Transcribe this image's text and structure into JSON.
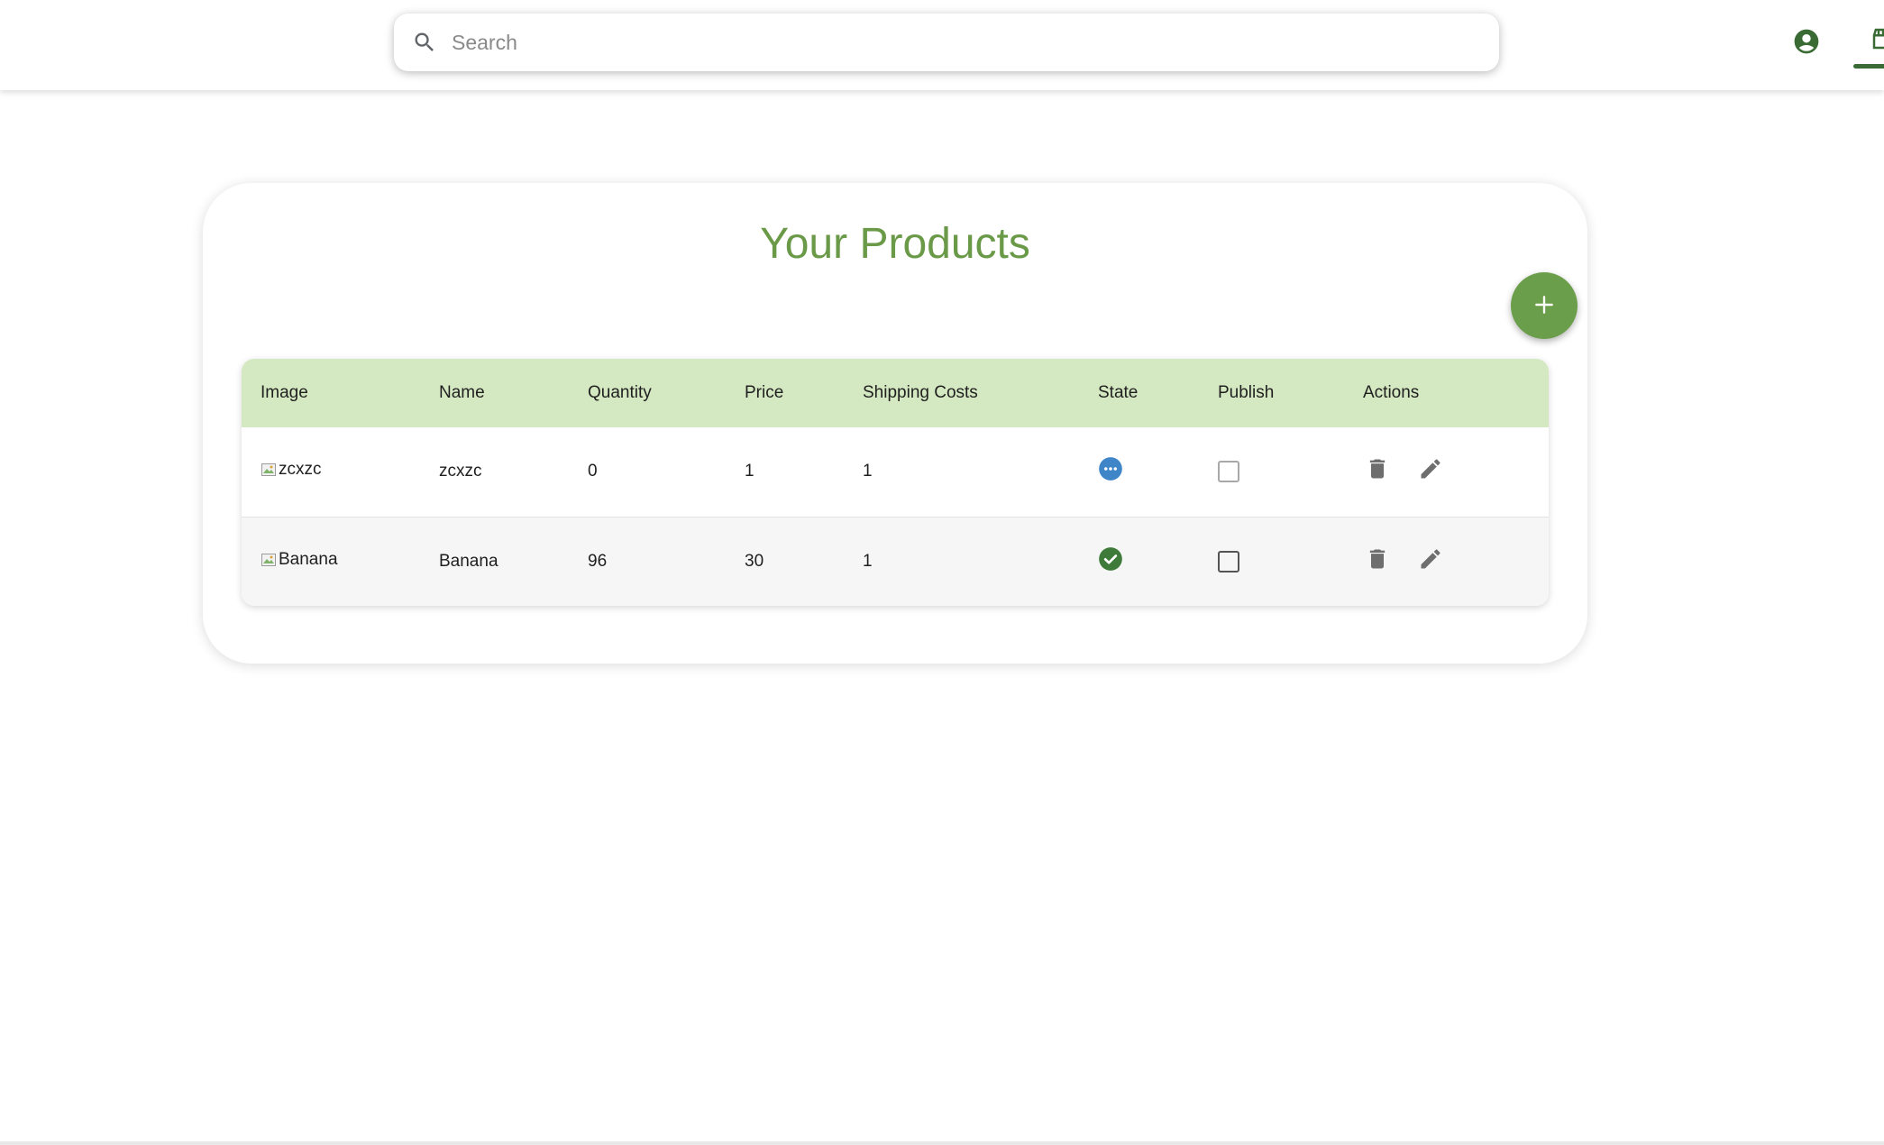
{
  "search": {
    "placeholder": "Search",
    "value": ""
  },
  "header": {
    "account_icon": "account-circle-icon",
    "store_tab_icon": "storefront-icon"
  },
  "main": {
    "title": "Your Products",
    "add_button_icon": "plus-icon"
  },
  "table": {
    "columns": [
      "Image",
      "Name",
      "Quantity",
      "Price",
      "Shipping Costs",
      "State",
      "Publish",
      "Actions"
    ],
    "rows": [
      {
        "image_alt": "zcxzc",
        "name": "zcxzc",
        "quantity": "0",
        "price": "1",
        "shipping": "1",
        "state": "pending",
        "state_icon": "more-horiz-circle-icon",
        "publish_checked": false,
        "publish_enabled": false
      },
      {
        "image_alt": "Banana",
        "name": "Banana",
        "quantity": "96",
        "price": "30",
        "shipping": "1",
        "state": "approved",
        "state_icon": "check-circle-icon",
        "publish_checked": false,
        "publish_enabled": true
      }
    ],
    "action_icons": [
      "trash-icon",
      "pencil-icon"
    ]
  },
  "colors": {
    "primary_green": "#6b9e4a",
    "title_green": "#6a9a48",
    "header_row_bg": "#d4e8c1",
    "dark_green": "#3a6b35",
    "pending_blue": "#3f86c9",
    "approved_green": "#3e7b3a",
    "icon_gray": "#6e6e6e"
  }
}
